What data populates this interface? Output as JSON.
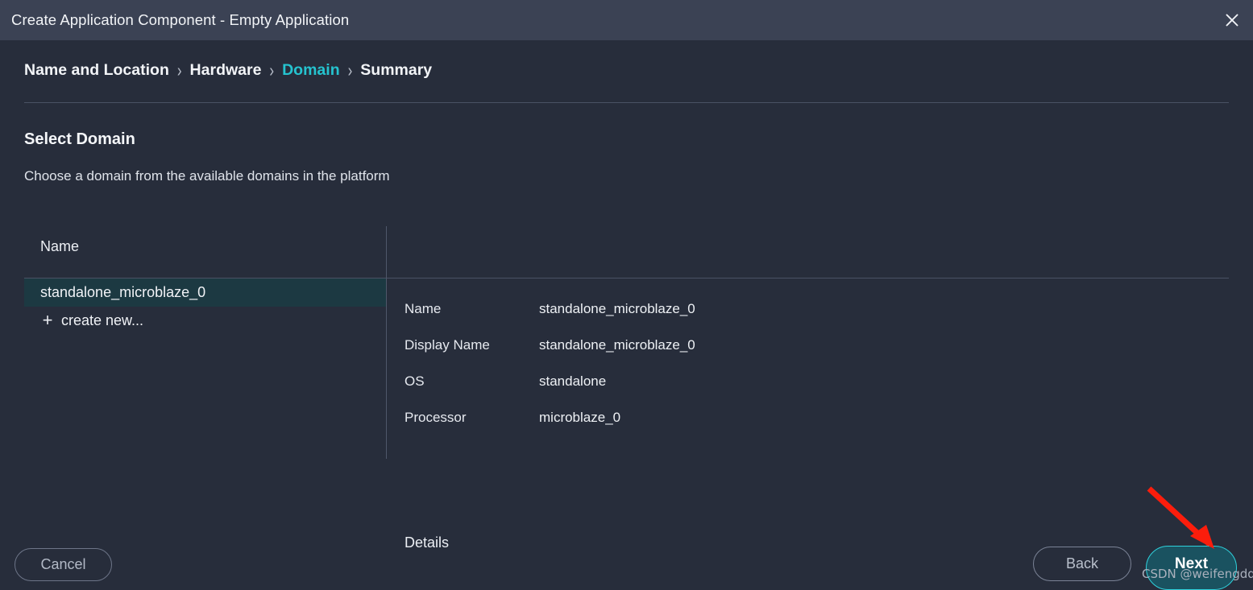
{
  "window": {
    "title": "Create Application Component - Empty Application",
    "close_icon": "close-icon"
  },
  "breadcrumb": {
    "separator": "›",
    "items": [
      {
        "label": "Name and Location",
        "active": false
      },
      {
        "label": "Hardware",
        "active": false
      },
      {
        "label": "Domain",
        "active": true
      },
      {
        "label": "Summary",
        "active": false
      }
    ]
  },
  "page": {
    "heading": "Select Domain",
    "subheading": "Choose a domain from the available domains in the platform"
  },
  "panes": {
    "name_column_header": "Name",
    "details_column_header": "Details"
  },
  "domain_list": {
    "items": [
      {
        "label": "standalone_microblaze_0",
        "selected": true,
        "icon": ""
      },
      {
        "label": "create new...",
        "selected": false,
        "icon": "+"
      }
    ]
  },
  "details": {
    "rows": [
      {
        "label": "Name",
        "value": "standalone_microblaze_0"
      },
      {
        "label": "Display Name",
        "value": "standalone_microblaze_0"
      },
      {
        "label": "OS",
        "value": "standalone"
      },
      {
        "label": "Processor",
        "value": "microblaze_0"
      }
    ]
  },
  "footer": {
    "cancel_label": "Cancel",
    "back_label": "Back",
    "next_label": "Next"
  },
  "annotation": {
    "arrow_color": "#fc1d0c",
    "watermark": "CSDN @weifengdq"
  },
  "colors": {
    "titlebar_bg": "#3b4254",
    "body_bg": "#272d3b",
    "accent_teal": "#25c3cf",
    "selected_row_bg": "#1c3942",
    "next_button_bg": "#1a5260",
    "next_button_border": "#2fd0db",
    "divider": "#4a5264"
  }
}
